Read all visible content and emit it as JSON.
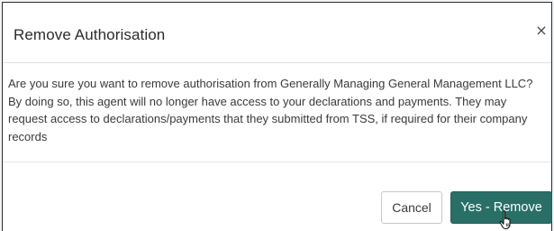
{
  "dialog": {
    "title": "Remove Authorisation",
    "close_glyph": "×",
    "message": "Are you sure you want to remove authorisation from Generally Managing General Management LLC? By doing so, this agent will no longer have access to your declarations and payments. They may request access to declarations/payments that they submitted from TSS, if required for their company records",
    "cancel_label": "Cancel",
    "confirm_label": "Yes - Remove"
  },
  "colors": {
    "confirm_button": "#2a6f67",
    "text": "#3a3a3a"
  },
  "icons": {
    "close": "close-icon",
    "pointer": "hand-pointer-cursor-icon"
  }
}
